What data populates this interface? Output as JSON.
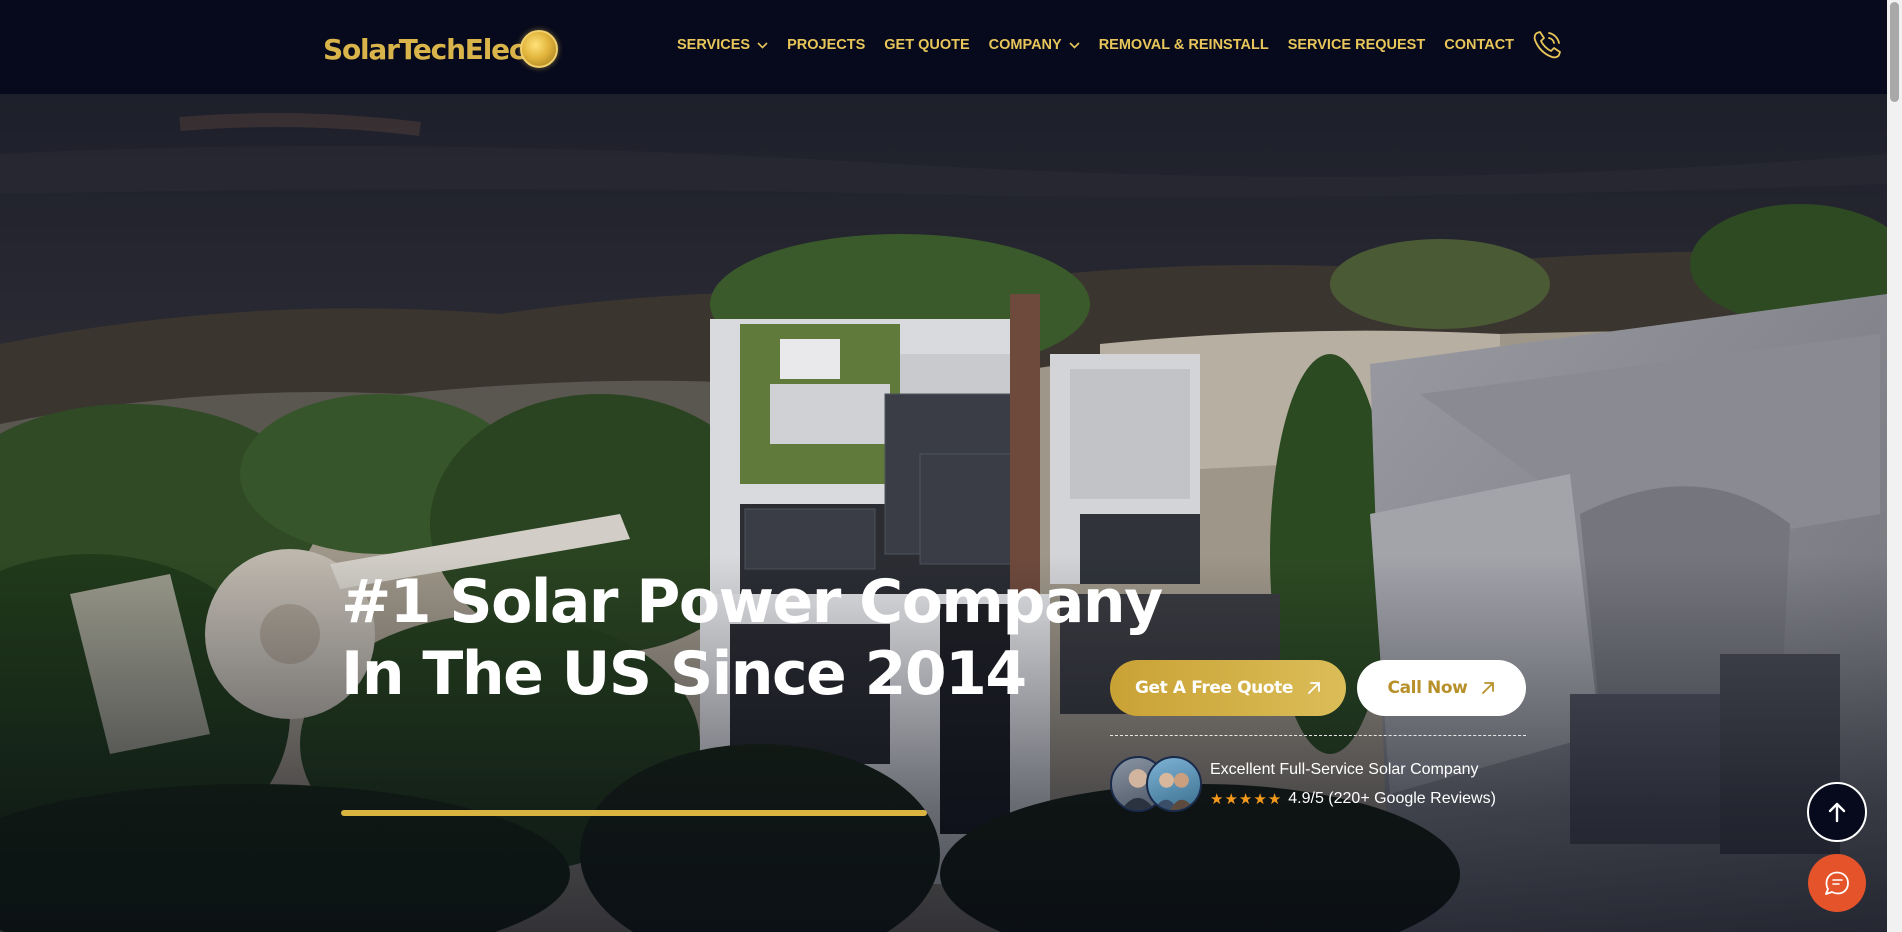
{
  "brand": {
    "name": "SolarTechElec",
    "logo_coin_icon": "sun-coin-icon"
  },
  "nav": {
    "items": [
      {
        "label": "SERVICES",
        "has_dropdown": true
      },
      {
        "label": "PROJECTS",
        "has_dropdown": false
      },
      {
        "label": "GET QUOTE",
        "has_dropdown": false
      },
      {
        "label": "COMPANY",
        "has_dropdown": true
      },
      {
        "label": "REMOVAL & REINSTALL",
        "has_dropdown": false
      },
      {
        "label": "SERVICE REQUEST",
        "has_dropdown": false
      },
      {
        "label": "CONTACT",
        "has_dropdown": false
      }
    ],
    "phone_icon": "phone-icon"
  },
  "hero": {
    "headline_line1": "#1 Solar Power Company",
    "headline_line2": "In The US Since 2014",
    "cta_primary": "Get A Free Quote",
    "cta_secondary": "Call Now",
    "review_title": "Excellent Full-Service Solar Company",
    "review_rating": "4.9/5 (220+ Google Reviews)",
    "stars": 5
  },
  "colors": {
    "header_bg": "#070a1c",
    "accent_gold": "#d9b440",
    "nav_text": "#e8c65a",
    "chat_button": "#e4532a",
    "star": "#f39a1d"
  },
  "floating": {
    "scroll_top_icon": "arrow-up-icon",
    "chat_icon": "chat-icon"
  }
}
